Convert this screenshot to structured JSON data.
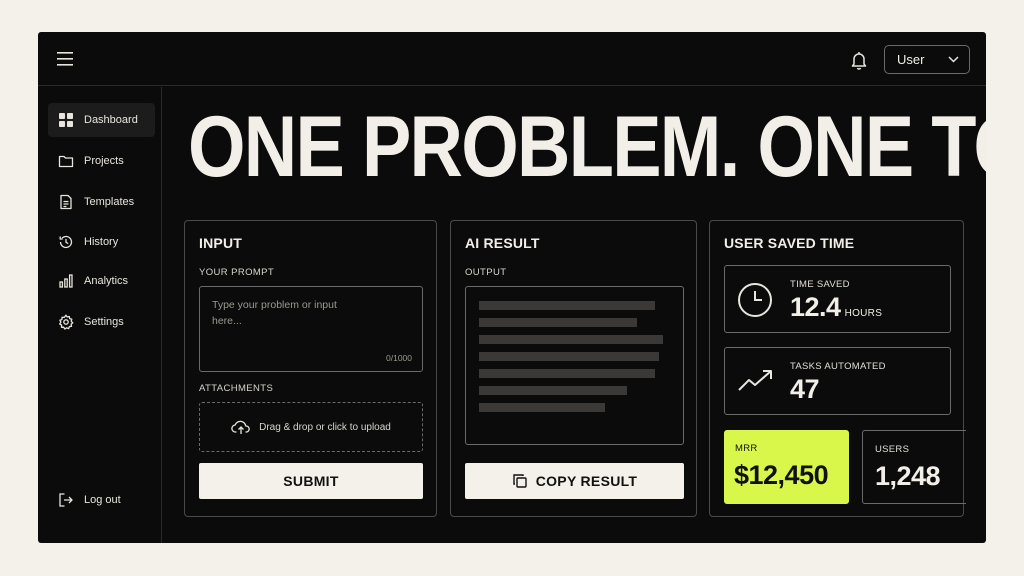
{
  "topbar": {
    "menu_icon": "hamburger-menu-icon",
    "bell_icon": "bell-icon",
    "user_select": {
      "value": "User",
      "icon": "chevron-down-icon"
    }
  },
  "sidebar": {
    "items": [
      {
        "label": "Dashboard",
        "icon": "grid-icon",
        "active": true
      },
      {
        "label": "Projects",
        "icon": "folder-icon"
      },
      {
        "label": "Templates",
        "icon": "document-icon"
      },
      {
        "label": "History",
        "icon": "history-icon"
      },
      {
        "label": "Analytics",
        "icon": "bar-chart-icon"
      },
      {
        "label": "Settings",
        "icon": "gear-icon"
      }
    ],
    "logout": {
      "label": "Log out",
      "icon": "logout-icon"
    }
  },
  "headline": "ONE PROBLEM. ONE TOOL.",
  "input_card": {
    "title": "INPUT",
    "prompt_label": "YOUR PROMPT",
    "prompt_placeholder": "Type your problem or input here...",
    "counter": "0/1000",
    "attachments_label": "ATTACHMENTS",
    "upload_text": "Drag & drop or click to upload",
    "upload_icon": "cloud-upload-icon",
    "submit_label": "SUBMIT"
  },
  "result_card": {
    "title": "AI RESULT",
    "output_label": "OUTPUT",
    "copy_label": "COPY RESULT",
    "copy_icon": "copy-icon"
  },
  "stats_card": {
    "title": "USER SAVED TIME",
    "time_saved": {
      "label": "TIME SAVED",
      "value": "12.4",
      "unit": "HOURS",
      "icon": "clock-icon"
    },
    "tasks": {
      "label": "TASKS AUTOMATED",
      "value": "47",
      "icon": "trend-up-icon"
    },
    "mrr": {
      "label": "MRR",
      "value": "$12,450"
    },
    "users": {
      "label": "USERS",
      "value": "1,248"
    }
  },
  "colors": {
    "background": "#f4f1ea",
    "panel": "#0b0b0b",
    "accent": "#d9f74a",
    "text": "#f2efe8"
  }
}
